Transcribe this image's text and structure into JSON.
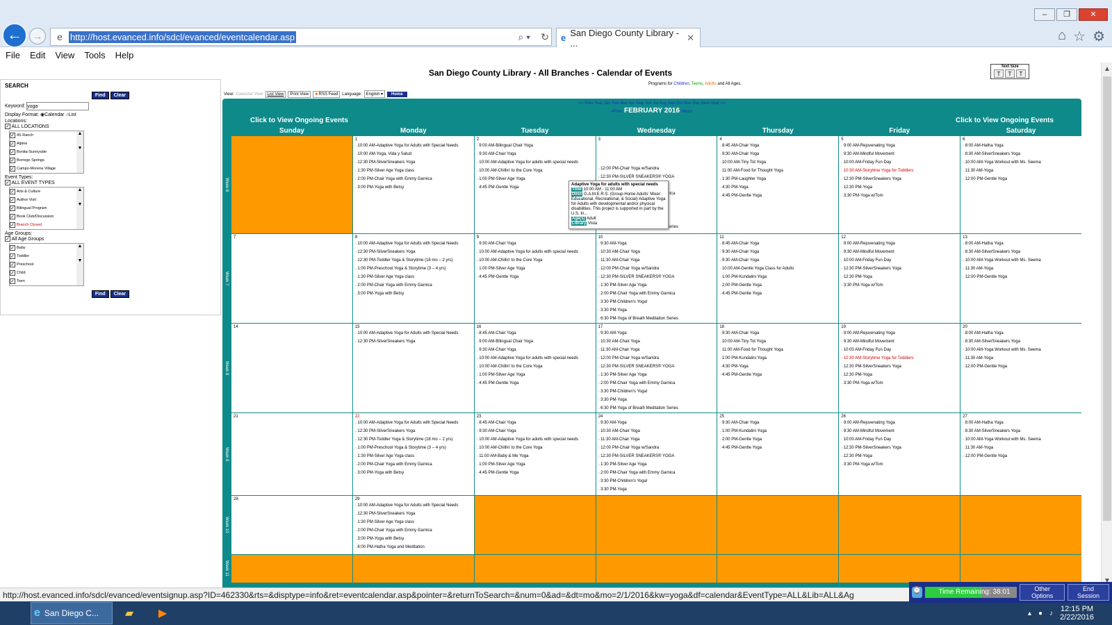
{
  "browser": {
    "url": "http://host.evanced.info/sdcl/evanced/eventcalendar.asp",
    "tab_title": "San Diego County Library - ...",
    "menu": [
      "File",
      "Edit",
      "View",
      "Tools",
      "Help"
    ],
    "status_url": "http://host.evanced.info/sdcl/evanced/eventsignup.asp?ID=462330&rts=&disptype=info&ret=eventcalendar.asp&pointer=&returnToSearch=&num=0&ad=&dt=mo&mo=2/1/2016&kw=yoga&df=calendar&EventType=ALL&Lib=ALL&Ag"
  },
  "page": {
    "title": "San Diego County Library - All Branches - Calendar of Events",
    "text_size_label": "Text Size"
  },
  "sidebar": {
    "search_label": "SEARCH",
    "find": "Find",
    "clear": "Clear",
    "keyword_label": "Keyword:",
    "keyword_value": "yoga",
    "display_format_label": "Display Format:",
    "calendar": "Calendar",
    "list": "List",
    "locations_label": "Locations:",
    "all_locations": "ALL LOCATIONS",
    "locations": [
      "4S Ranch",
      "Alpine",
      "Bonita-Sunnyside",
      "Borrego Springs",
      "Campo-Morena Village"
    ],
    "event_types_label": "Event Types:",
    "all_event_types": "ALL EVENT TYPES",
    "event_types": [
      "Arts & Culture",
      "Author Visit",
      "Bilingual Program",
      "Book Club/Discussion",
      "Branch Closed"
    ],
    "age_groups_label": "Age Groups:",
    "all_age_groups": "All Age Groups",
    "age_groups": [
      "Baby",
      "Toddler",
      "Preschool",
      "Child",
      "Teen"
    ]
  },
  "toolbar": {
    "view": "View:",
    "calendar_view": "Calendar View",
    "list_view": "List View",
    "print_view": "Print View",
    "rss": "RSS Feed",
    "language": "Language:",
    "language_value": "English",
    "home": "Home"
  },
  "programs": {
    "prefix": "Programs for",
    "children": "Children",
    "teens": "Teens",
    "adults": "Adults",
    "suffix": "and All Ages."
  },
  "calendar": {
    "nav": "<< Prev Year    Jan  Feb  Mar  Apr  May  Jun  Jul  Aug  Sep  Oct  Nov  Dec    Next Year >>",
    "prev": "<Prev",
    "month": "FEBRUARY 2016",
    "next": "Next>",
    "ongoing": "Click to View Ongoing Events",
    "days": [
      "Sunday",
      "Monday",
      "Tuesday",
      "Wednesday",
      "Thursday",
      "Friday",
      "Saturday"
    ],
    "weeks": [
      {
        "label": "Week 6",
        "cells": [
          {
            "empty": true
          },
          {
            "day": "1",
            "events": [
              "10:00 AM-Adaptive Yoga for Adults with Special Needs",
              "10:00 AM-Yoga, Vida y Salud",
              "12:30 PM-SilverSneakers Yoga",
              "1:30 PM-Silver Age Yoga class",
              "2:00 PM-Chair Yoga with Emmy Garnica",
              "3:00 PM-Yoga with Betsy"
            ]
          },
          {
            "day": "2",
            "events": [
              "9:00 AM-Bilingual Chair Yoga",
              "9:30 AM-Chair Yoga",
              "10:00 AM-Adaptive Yoga for adults with special needs",
              "10:00 AM-Chillin' to the Core Yoga",
              "1:00 PM-Silver Age Yoga",
              "4:45 PM-Gentle Yoga"
            ]
          },
          {
            "day": "3",
            "events": [
              "",
              "",
              "",
              "12:00 PM-Chair Yoga w/Sandra",
              "12:30 PM-SILVER SNEAKERS® YOGA",
              "1:30 PM-Silver Age Yoga",
              "2:00 PM-Chair Yoga with Emmy Garnica",
              "3:30 PM-Children's Yoga!",
              "3:30 PM-Kids Yoga",
              "3:30 PM-Yoga",
              "6:30 PM-Yoga of Breath Meditation Series"
            ]
          },
          {
            "day": "4",
            "events": [
              "8:45 AM-Chair Yoga",
              "9:30 AM-Chair Yoga",
              "10:00 AM-Tiny Tot Yoga",
              "11:00 AM-Food for Thought Yoga",
              "1:30 PM-Laughter Yoga",
              "4:30 PM-Yoga",
              "4:45 PM-Gentle Yoga"
            ]
          },
          {
            "day": "5",
            "events": [
              "9:00 AM-Rejuvenating Yoga",
              "9:30 AM-Mindful Movement",
              "10:00 AM-Friday Fun Day",
              "10:30 AM-Storytime Yoga for Toddlers",
              "12:30 PM-SilverSneakers Yoga",
              "12:30 PM-Yoga",
              "3:30 PM-Yoga w/Tom"
            ]
          },
          {
            "day": "6",
            "events": [
              "8:00 AM-Hatha Yoga",
              "8:30 AM-SilverSneakers Yoga",
              "10:00 AM-Yoga Workout with Ms. Seema",
              "11:30 AM-Yoga",
              "12:00 PM-Gentle Yoga"
            ]
          }
        ]
      },
      {
        "label": "Week 7",
        "cells": [
          {
            "day": "7",
            "events": []
          },
          {
            "day": "8",
            "events": [
              "10:00 AM-Adaptive Yoga for Adults with Special Needs",
              "12:30 PM-SilverSneakers Yoga",
              "12:30 PM-Toddler Yoga & Storytime (18 mo – 2 yrs)",
              "1:00 PM-Preschool Yoga & Storytime (3 – 4 yrs)",
              "1:30 PM-Silver Age Yoga class",
              "2:00 PM-Chair Yoga with Emmy Garnica",
              "3:00 PM-Yoga with Betsy"
            ]
          },
          {
            "day": "9",
            "events": [
              "9:30 AM-Chair Yoga",
              "10:00 AM-Adaptive Yoga for adults with special needs",
              "10:00 AM-Chillin' to the Core Yoga",
              "1:00 PM-Silver Age Yoga",
              "4:45 PM-Gentle Yoga"
            ]
          },
          {
            "day": "10",
            "events": [
              "9:30 AM-Yoga",
              "10:30 AM-Chair Yoga",
              "11:30 AM-Chair Yoga",
              "12:00 PM-Chair Yoga w/Sandra",
              "12:30 PM-SILVER SNEAKERS® YOGA",
              "1:30 PM-Silver Age Yoga",
              "2:00 PM-Chair Yoga with Emmy Garnica",
              "3:30 PM-Children's Yoga!",
              "3:30 PM-Yoga",
              "6:30 PM-Yoga of Breath Meditation Series"
            ]
          },
          {
            "day": "11",
            "events": [
              "8:45 AM-Chair Yoga",
              "9:30 AM-Chair Yoga",
              "9:30 AM-Chair Yoga",
              "10:00 AM-Gentle Yoga Class for Adults",
              "1:00 PM-Kundalini Yoga",
              "2:00 PM-Gentle Yoga",
              "4:45 PM-Gentle Yoga"
            ]
          },
          {
            "day": "12",
            "events": [
              "9:00 AM-Rejuvenating Yoga",
              "9:30 AM-Mindful Movement",
              "10:00 AM-Friday Fun Day",
              "12:30 PM-SilverSneakers Yoga",
              "12:30 PM-Yoga",
              "3:30 PM-Yoga w/Tom"
            ]
          },
          {
            "day": "13",
            "events": [
              "8:00 AM-Hatha Yoga",
              "8:30 AM-SilverSneakers Yoga",
              "10:00 AM-Yoga Workout with Ms. Seema",
              "11:30 AM-Yoga",
              "12:00 PM-Gentle Yoga"
            ]
          }
        ]
      },
      {
        "label": "Week 8",
        "cells": [
          {
            "day": "14",
            "events": []
          },
          {
            "day": "15",
            "events": [
              "10:00 AM-Adaptive Yoga for Adults with Special Needs",
              "12:30 PM-SilverSneakers Yoga"
            ]
          },
          {
            "day": "16",
            "events": [
              "8:45 AM-Chair Yoga",
              "9:00 AM-Bilingual Chair Yoga",
              "9:30 AM-Chair Yoga",
              "10:00 AM-Adaptive Yoga for adults with special needs",
              "10:00 AM-Chillin' to the Core Yoga",
              "1:00 PM-Silver Age Yoga",
              "4:45 PM-Gentle Yoga"
            ]
          },
          {
            "day": "17",
            "events": [
              "9:30 AM-Yoga",
              "10:30 AM-Chair Yoga",
              "11:30 AM-Chair Yoga",
              "12:00 PM-Chair Yoga w/Sandra",
              "12:30 PM-SILVER SNEAKERS® YOGA",
              "1:30 PM-Silver Age Yoga",
              "2:00 PM-Chair Yoga with Emmy Garnica",
              "3:30 PM-Children's Yoga!",
              "3:30 PM-Yoga",
              "6:30 PM-Yoga of Breath Meditation Series"
            ]
          },
          {
            "day": "18",
            "events": [
              "9:30 AM-Chair Yoga",
              "10:00 AM-Tiny Tot Yoga",
              "11:00 AM-Food for Thought Yoga",
              "1:00 PM-Kundalini Yoga",
              "4:30 PM-Yoga",
              "4:45 PM-Gentle Yoga"
            ]
          },
          {
            "day": "19",
            "events": [
              "9:00 AM-Rejuvenating Yoga",
              "9:30 AM-Mindful Movement",
              "10:00 AM-Friday Fun Day",
              "10:30 AM-Storytime Yoga for Toddlers",
              "12:30 PM-SilverSneakers Yoga",
              "12:30 PM-Yoga",
              "3:30 PM-Yoga w/Tom"
            ]
          },
          {
            "day": "20",
            "events": [
              "8:00 AM-Hatha Yoga",
              "8:30 AM-SilverSneakers Yoga",
              "10:00 AM-Yoga Workout with Ms. Seema",
              "11:30 AM-Yoga",
              "12:00 PM-Gentle Yoga"
            ]
          }
        ]
      },
      {
        "label": "Week 9",
        "cells": [
          {
            "day": "21",
            "events": []
          },
          {
            "day": "22",
            "events": [
              "10:00 AM-Adaptive Yoga for Adults with Special Needs",
              "12:30 PM-SilverSneakers Yoga",
              "12:30 PM-Toddler Yoga & Storytime (18 mo – 2 yrs)",
              "1:00 PM-Preschool Yoga & Storytime (3 – 4 yrs)",
              "1:30 PM-Silver Age Yoga class",
              "2:00 PM-Chair Yoga with Emmy Garnica",
              "3:00 PM-Yoga with Betsy"
            ]
          },
          {
            "day": "23",
            "events": [
              "8:45 AM-Chair Yoga",
              "9:30 AM-Chair Yoga",
              "10:00 AM-Adaptive Yoga for adults with special needs",
              "10:00 AM-Chillin' to the Core Yoga",
              "11:00 AM-Baby & Me Yoga",
              "1:00 PM-Silver Age Yoga",
              "4:45 PM-Gentle Yoga"
            ]
          },
          {
            "day": "24",
            "events": [
              "9:30 AM-Yoga",
              "10:30 AM-Chair Yoga",
              "11:30 AM-Chair Yoga",
              "12:00 PM-Chair Yoga w/Sandra",
              "12:30 PM-SILVER SNEAKERS® YOGA",
              "1:30 PM-Silver Age Yoga",
              "2:00 PM-Chair Yoga with Emmy Garnica",
              "3:30 PM-Children's Yoga!",
              "3:30 PM-Yoga"
            ]
          },
          {
            "day": "25",
            "events": [
              "9:30 AM-Chair Yoga",
              "1:00 PM-Kundalini Yoga",
              "2:00 PM-Gentle Yoga",
              "4:45 PM-Gentle Yoga"
            ]
          },
          {
            "day": "26",
            "events": [
              "9:00 AM-Rejuvenating Yoga",
              "9:30 AM-Mindful Movement",
              "10:00 AM-Friday Fun Day",
              "12:30 PM-SilverSneakers Yoga",
              "12:30 PM-Yoga",
              "3:30 PM-Yoga w/Tom"
            ]
          },
          {
            "day": "27",
            "events": [
              "8:00 AM-Hatha Yoga",
              "8:30 AM-SilverSneakers Yoga",
              "10:00 AM-Yoga Workout with Ms. Seema",
              "11:30 AM-Yoga",
              "12:00 PM-Gentle Yoga"
            ]
          }
        ]
      },
      {
        "label": "Week 10",
        "cells": [
          {
            "day": "28",
            "events": []
          },
          {
            "day": "29",
            "events": [
              "10:00 AM-Adaptive Yoga for Adults with Special Needs",
              "12:30 PM-SilverSneakers Yoga",
              "1:30 PM-Silver Age Yoga class",
              "2:00 PM-Chair Yoga with Emmy Garnica",
              "3:00 PM-Yoga with Betsy",
              "6:00 PM-Hatha Yoga and Meditation"
            ]
          },
          {
            "empty": true
          },
          {
            "empty": true
          },
          {
            "empty": true
          },
          {
            "empty": true
          },
          {
            "empty": true
          }
        ]
      },
      {
        "label": "Week 11",
        "cells": [
          {
            "empty": true
          },
          {
            "empty": true
          },
          {
            "empty": true
          },
          {
            "empty": true
          },
          {
            "empty": true
          },
          {
            "empty": true
          },
          {
            "empty": true
          }
        ]
      }
    ]
  },
  "tooltip": {
    "title": "Adaptive Yoga for adults with special needs",
    "time_tag": "Time",
    "time": "10:00 AM - 11:00 AM",
    "desc_tag": "Desc",
    "desc": "G.A.M.E.R.S. (Group-Home Adults' Mixer: Educational, Recreational, & Social) Adaptive Yoga for Adults with developmental and/or physical disabilities. This project is supported in part by the U.S. In...",
    "ages_tag": "Age(s)",
    "ages": "Adult",
    "library_tag": "Library",
    "library": "Vista"
  },
  "session": {
    "time_remaining": "Time Remaining: 38:01",
    "other_options": "Other Options",
    "end_session": "End Session"
  },
  "taskbar": {
    "ie_label": "San Diego C...",
    "clock_time": "12:15 PM",
    "clock_date": "2/22/2016"
  },
  "colors": {
    "teal": "#0f8a8a",
    "orange": "#ff9900",
    "navy": "#1a2f8a"
  },
  "icons": [
    "back-icon",
    "forward-icon",
    "refresh-icon",
    "ie-icon",
    "search-icon",
    "home-icon",
    "star-icon",
    "gear-icon",
    "folder-icon",
    "media-icon"
  ]
}
